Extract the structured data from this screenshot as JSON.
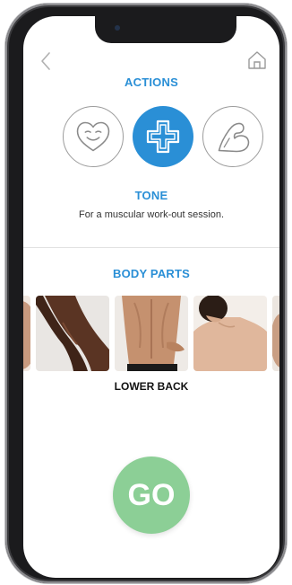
{
  "colors": {
    "accent": "#2a8fd6",
    "go_button": "#8ccf96",
    "outline": "#9c9c9c"
  },
  "actions": {
    "title": "ACTIONS",
    "items": [
      {
        "icon": "smiling-heart-icon",
        "state": "default"
      },
      {
        "icon": "medical-cross-icon",
        "state": "selected"
      },
      {
        "icon": "flexed-arm-icon",
        "state": "default"
      }
    ]
  },
  "selected_action": {
    "name": "TONE",
    "description": "For  a muscular work-out session."
  },
  "body_parts": {
    "title": "BODY PARTS",
    "items": [
      {
        "image": "body-photo-partial"
      },
      {
        "image": "legs-photo"
      },
      {
        "image": "lower-back-photo"
      },
      {
        "image": "upper-back-photo"
      },
      {
        "image": "body-photo-partial"
      }
    ],
    "selected_label": "LOWER BACK"
  },
  "go_button": {
    "label": "GO"
  }
}
